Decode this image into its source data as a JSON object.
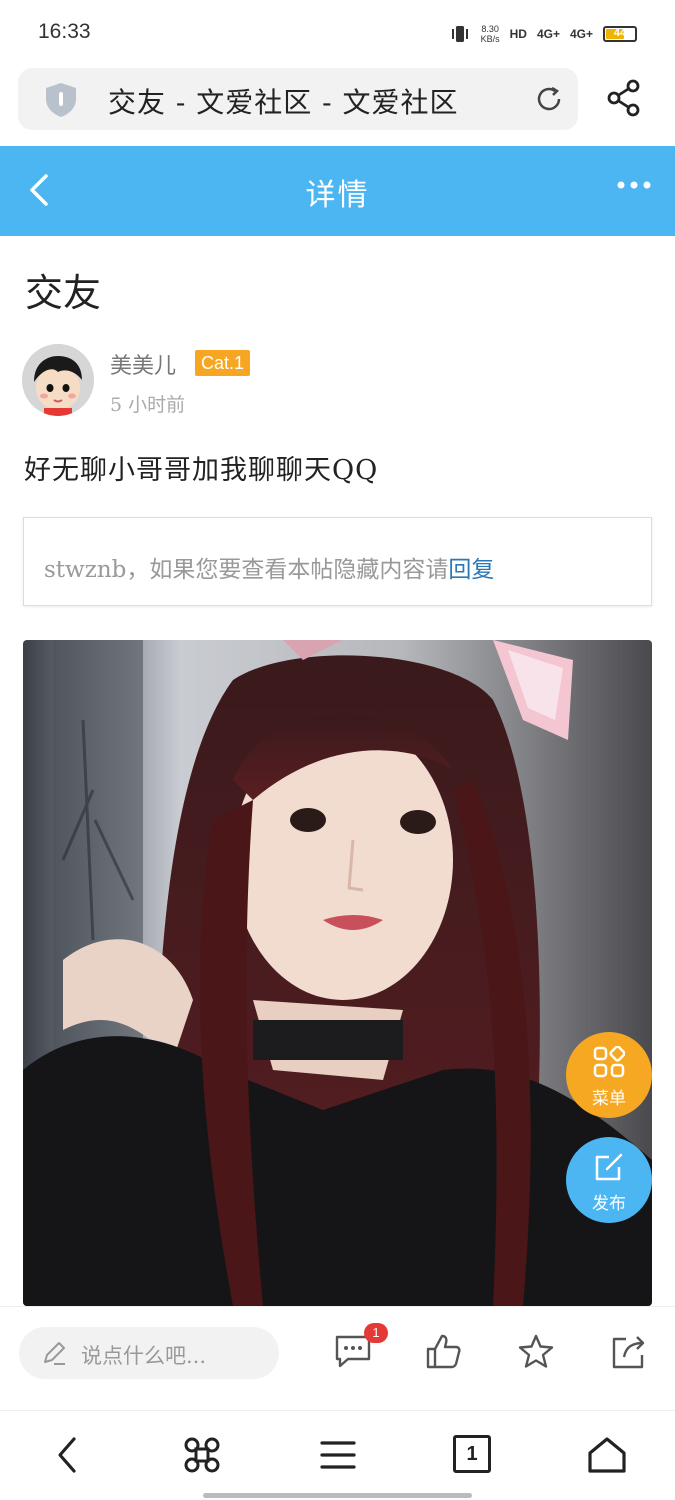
{
  "status_bar": {
    "time": "16:33",
    "net_speed_value": "8.30",
    "net_speed_unit": "KB/s",
    "hd_label": "HD",
    "sim1_label": "4G+",
    "sim2_label": "4G+",
    "battery": "44"
  },
  "browser": {
    "page_title": "交友 - 文爱社区 - 文爱社区"
  },
  "header": {
    "title": "详情"
  },
  "post": {
    "title": "交友",
    "author": "美美儿",
    "level_badge": "Cat.1",
    "time_ago": "5 小时前",
    "body": "好无聊小哥哥加我聊聊天QQ",
    "hidden_notice": "stwznb，如果您要查看本帖隐藏内容请",
    "hidden_link": "回复"
  },
  "fab": {
    "menu_label": "菜单",
    "post_label": "发布"
  },
  "action_bar": {
    "comment_placeholder": "说点什么吧...",
    "comment_count_badge": "1"
  },
  "nav": {
    "tab_count": "1"
  },
  "colors": {
    "header_blue": "#4cb6f2",
    "badge_orange": "#f6a623",
    "fab_orange": "#f7a823",
    "link_blue": "#2a78b8"
  }
}
